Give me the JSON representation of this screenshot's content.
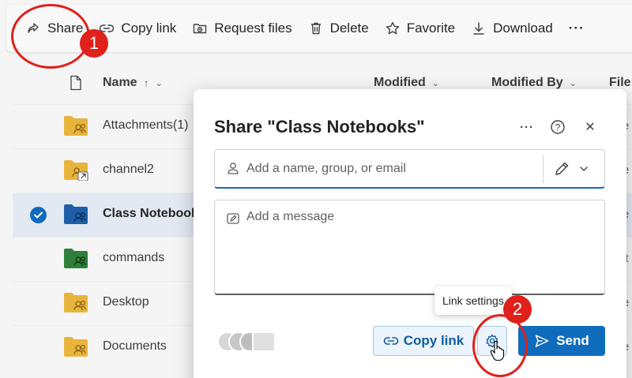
{
  "toolbar": {
    "items": [
      {
        "label": "Share",
        "icon": "share-icon"
      },
      {
        "label": "Copy link",
        "icon": "link-icon"
      },
      {
        "label": "Request files",
        "icon": "request-files-icon"
      },
      {
        "label": "Delete",
        "icon": "trash-icon"
      },
      {
        "label": "Favorite",
        "icon": "star-icon"
      },
      {
        "label": "Download",
        "icon": "download-icon"
      }
    ],
    "more_glyph": "···"
  },
  "columns": {
    "name": "Name",
    "name_sort": "↑",
    "modified": "Modified",
    "modified_by": "Modified By",
    "file": "File"
  },
  "files": [
    {
      "name": "Attachments(1)",
      "color": "#e8b53c",
      "edge": "e",
      "selected": false
    },
    {
      "name": "channel2",
      "color": "#e8b53c",
      "edge": "e",
      "selected": false,
      "shortcut": true
    },
    {
      "name": "Class Notebooks",
      "color": "#1f5fa8",
      "edge": "e",
      "selected": true
    },
    {
      "name": "commands",
      "color": "#2f7f3a",
      "edge": "it",
      "selected": false
    },
    {
      "name": "Desktop",
      "color": "#e8b53c",
      "edge": "e",
      "selected": false
    },
    {
      "name": "Documents",
      "color": "#e8b53c",
      "edge": "e",
      "selected": false
    }
  ],
  "dialog": {
    "title": "Share \"Class Notebooks\"",
    "more_glyph": "···",
    "help_glyph": "?",
    "close_glyph": "✕",
    "people_placeholder": "Add a name, group, or email",
    "message_placeholder": "Add a message",
    "copy_link_label": "Copy link",
    "send_label": "Send",
    "tooltip": "Link settings"
  },
  "annotations": {
    "step1": "1",
    "step2": "2",
    "color": "#e0201a"
  },
  "colors": {
    "accent": "#0f6cbd",
    "selected_row": "#e3e9f2"
  }
}
